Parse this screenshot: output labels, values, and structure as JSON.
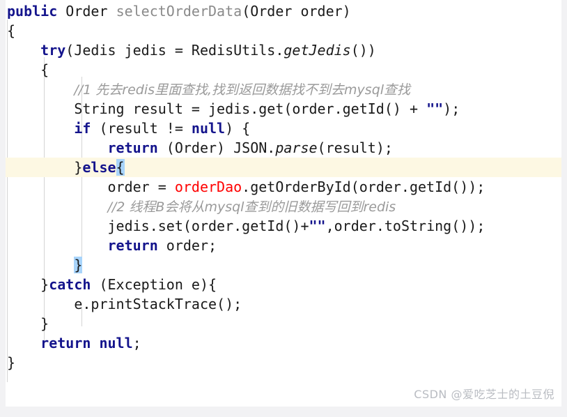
{
  "editor": {
    "language": "java",
    "theme": "light",
    "colors": {
      "background": "#ffffff",
      "page_background": "#f2f2f4",
      "keyword": "#14148c",
      "identifier": "#1a1a1a",
      "method_name": "#8a8a8a",
      "field_red": "#ff0000",
      "comment": "#9a9a9a",
      "string": "#14148c",
      "current_line_highlight": "#fdf8e3",
      "brace_match_highlight": "#a8d4fb",
      "indent_guide": "#d4d4d4",
      "watermark": "#b9bcc2"
    },
    "lines": [
      {
        "n": 1,
        "indent": 0,
        "highlighted": false,
        "tokens": [
          {
            "t": "public",
            "k": "kw"
          },
          {
            "t": " ",
            "k": "plain"
          },
          {
            "t": "Order",
            "k": "type"
          },
          {
            "t": " ",
            "k": "plain"
          },
          {
            "t": "selectOrderData",
            "k": "mname"
          },
          {
            "t": "(Order order)",
            "k": "plain"
          }
        ]
      },
      {
        "n": 2,
        "indent": 0,
        "highlighted": false,
        "tokens": [
          {
            "t": "{",
            "k": "plain"
          }
        ]
      },
      {
        "n": 3,
        "indent": 1,
        "highlighted": false,
        "tokens": [
          {
            "t": "try",
            "k": "kw"
          },
          {
            "t": "(Jedis jedis = RedisUtils.",
            "k": "plain"
          },
          {
            "t": "getJedis",
            "k": "stat"
          },
          {
            "t": "())",
            "k": "plain"
          }
        ]
      },
      {
        "n": 4,
        "indent": 1,
        "highlighted": false,
        "tokens": [
          {
            "t": "{",
            "k": "plain"
          }
        ]
      },
      {
        "n": 5,
        "indent": 2,
        "highlighted": false,
        "tokens": [
          {
            "t": "//1 先去redis里面查找,找到返回数据找不到去mysql查找",
            "k": "comment"
          }
        ]
      },
      {
        "n": 6,
        "indent": 2,
        "highlighted": false,
        "tokens": [
          {
            "t": "String result = jedis.get(order.getId() + ",
            "k": "plain"
          },
          {
            "t": "\"\"",
            "k": "str"
          },
          {
            "t": ");",
            "k": "plain"
          }
        ]
      },
      {
        "n": 7,
        "indent": 2,
        "highlighted": false,
        "tokens": [
          {
            "t": "if",
            "k": "kw"
          },
          {
            "t": " (result != ",
            "k": "plain"
          },
          {
            "t": "null",
            "k": "kw"
          },
          {
            "t": ") {",
            "k": "plain"
          }
        ]
      },
      {
        "n": 8,
        "indent": 3,
        "highlighted": false,
        "tokens": [
          {
            "t": "return",
            "k": "kw"
          },
          {
            "t": " (Order) JSON.",
            "k": "plain"
          },
          {
            "t": "parse",
            "k": "stat"
          },
          {
            "t": "(result);",
            "k": "plain"
          }
        ]
      },
      {
        "n": 9,
        "indent": 2,
        "highlighted": true,
        "tokens": [
          {
            "t": "}",
            "k": "plain"
          },
          {
            "t": "else",
            "k": "kw"
          },
          {
            "t": "{",
            "k": "plain",
            "sel": true
          }
        ]
      },
      {
        "n": 10,
        "indent": 3,
        "highlighted": false,
        "tokens": [
          {
            "t": "order = ",
            "k": "plain"
          },
          {
            "t": "orderDao",
            "k": "field"
          },
          {
            "t": ".getOrderById(order.getId());",
            "k": "plain"
          }
        ]
      },
      {
        "n": 11,
        "indent": 3,
        "highlighted": false,
        "tokens": [
          {
            "t": "//2 线程B会将从mysql查到的旧数据写回到redis",
            "k": "comment"
          }
        ]
      },
      {
        "n": 12,
        "indent": 3,
        "highlighted": false,
        "tokens": [
          {
            "t": "jedis.set(order.getId()+",
            "k": "plain"
          },
          {
            "t": "\"\"",
            "k": "str"
          },
          {
            "t": ",order.toString());",
            "k": "plain"
          }
        ]
      },
      {
        "n": 13,
        "indent": 3,
        "highlighted": false,
        "tokens": [
          {
            "t": "return",
            "k": "kw"
          },
          {
            "t": " order;",
            "k": "plain"
          }
        ]
      },
      {
        "n": 14,
        "indent": 2,
        "highlighted": false,
        "tokens": [
          {
            "t": "}",
            "k": "plain",
            "sel": true
          }
        ]
      },
      {
        "n": 15,
        "indent": 1,
        "highlighted": false,
        "tokens": [
          {
            "t": "}",
            "k": "plain"
          },
          {
            "t": "catch",
            "k": "kw"
          },
          {
            "t": " (Exception e){",
            "k": "plain"
          }
        ]
      },
      {
        "n": 16,
        "indent": 2,
        "highlighted": false,
        "tokens": [
          {
            "t": "e.printStackTrace();",
            "k": "plain"
          }
        ]
      },
      {
        "n": 17,
        "indent": 1,
        "highlighted": false,
        "tokens": [
          {
            "t": "}",
            "k": "plain"
          }
        ]
      },
      {
        "n": 18,
        "indent": 1,
        "highlighted": false,
        "tokens": [
          {
            "t": "return",
            "k": "kw"
          },
          {
            "t": " ",
            "k": "plain"
          },
          {
            "t": "null",
            "k": "kw"
          },
          {
            "t": ";",
            "k": "plain"
          }
        ]
      },
      {
        "n": 19,
        "indent": 0,
        "highlighted": false,
        "tokens": [
          {
            "t": "}",
            "k": "plain"
          }
        ]
      }
    ]
  },
  "watermark": {
    "text": "CSDN @爱吃芝士的土豆倪"
  }
}
